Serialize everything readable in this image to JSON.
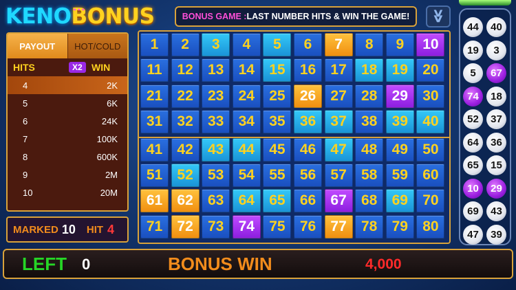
{
  "logo": {
    "keno": "KENO",
    "bonus": "BONUS",
    "dots": "•••"
  },
  "banner": {
    "prefix": "BONUS GAME : ",
    "text": "LAST NUMBER HITS & WIN THE GAME!"
  },
  "collapse_icon": "chevron-double-down-icon",
  "payout": {
    "tabs": [
      {
        "label": "PAYOUT",
        "active": true
      },
      {
        "label": "HOT/COLD",
        "active": false
      }
    ],
    "header": {
      "hits": "HITS",
      "multiplier": "X2",
      "win": "WIN"
    },
    "rows": [
      {
        "hits": "4",
        "win": "2K",
        "highlight": true
      },
      {
        "hits": "5",
        "win": "6K"
      },
      {
        "hits": "6",
        "win": "24K"
      },
      {
        "hits": "7",
        "win": "100K"
      },
      {
        "hits": "8",
        "win": "600K"
      },
      {
        "hits": "9",
        "win": "2M"
      },
      {
        "hits": "10",
        "win": "20M"
      }
    ]
  },
  "status": {
    "marked_label": "MARKED",
    "marked": "10",
    "hit_label": "HIT",
    "hit": "4"
  },
  "board": {
    "numbers": [
      1,
      2,
      3,
      4,
      5,
      6,
      7,
      8,
      9,
      10,
      11,
      12,
      13,
      14,
      15,
      16,
      17,
      18,
      19,
      20,
      21,
      22,
      23,
      24,
      25,
      26,
      27,
      28,
      29,
      30,
      31,
      32,
      33,
      34,
      35,
      36,
      37,
      38,
      39,
      40,
      41,
      42,
      43,
      44,
      45,
      46,
      47,
      48,
      49,
      50,
      51,
      52,
      53,
      54,
      55,
      56,
      57,
      58,
      59,
      60,
      61,
      62,
      63,
      64,
      65,
      66,
      67,
      68,
      69,
      70,
      71,
      72,
      73,
      74,
      75,
      76,
      77,
      78,
      79,
      80
    ],
    "drawn": [
      3,
      5,
      15,
      18,
      19,
      36,
      37,
      39,
      40,
      43,
      44,
      47,
      52,
      64,
      65,
      69
    ],
    "marked": [
      7,
      26,
      61,
      62,
      72,
      77
    ],
    "hits": [
      10,
      29,
      67,
      74
    ]
  },
  "drawn_balls": [
    {
      "number": "44",
      "hit": false
    },
    {
      "number": "40",
      "hit": false
    },
    {
      "number": "19",
      "hit": false
    },
    {
      "number": "3",
      "hit": false
    },
    {
      "number": "5",
      "hit": false
    },
    {
      "number": "67",
      "hit": true
    },
    {
      "number": "74",
      "hit": true
    },
    {
      "number": "18",
      "hit": false
    },
    {
      "number": "52",
      "hit": false
    },
    {
      "number": "37",
      "hit": false
    },
    {
      "number": "64",
      "hit": false
    },
    {
      "number": "36",
      "hit": false
    },
    {
      "number": "65",
      "hit": false
    },
    {
      "number": "15",
      "hit": false
    },
    {
      "number": "10",
      "hit": true
    },
    {
      "number": "29",
      "hit": true
    },
    {
      "number": "69",
      "hit": false
    },
    {
      "number": "43",
      "hit": false
    },
    {
      "number": "47",
      "hit": false
    },
    {
      "number": "39",
      "hit": false
    }
  ],
  "bottom": {
    "left_label": "LEFT",
    "left_value": "0",
    "bonus_label": "BONUS WIN",
    "bonus_value": "4,000"
  }
}
